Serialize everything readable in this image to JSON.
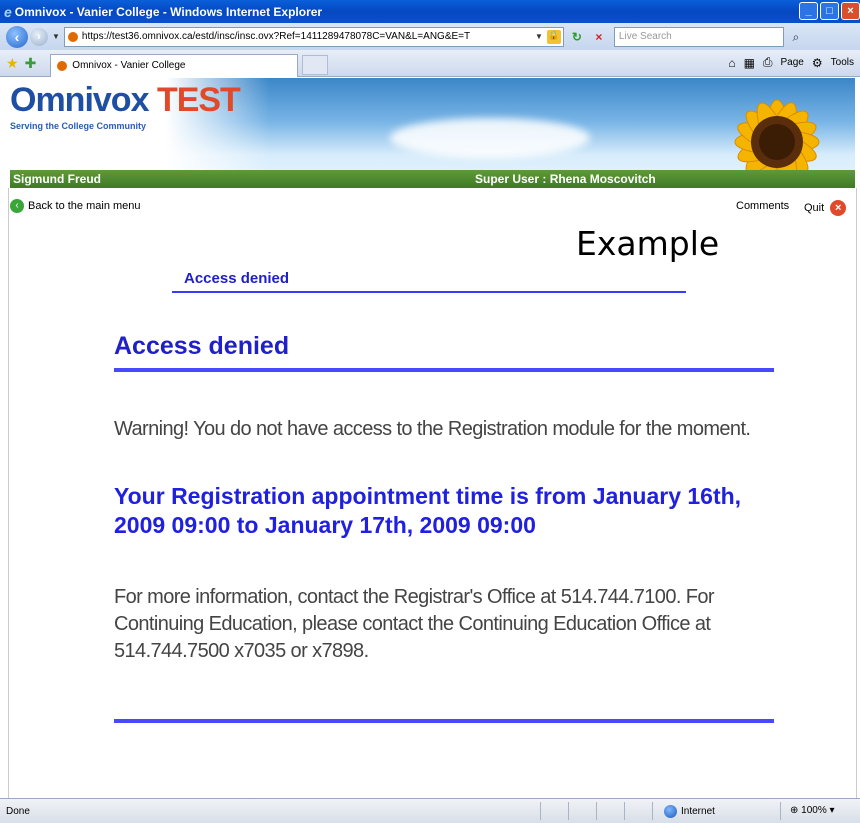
{
  "window": {
    "title": "Omnivox - Vanier College - Windows Internet Explorer"
  },
  "addressbar": {
    "url": "https://test36.omnivox.ca/estd/insc/insc.ovx?Ref=1411289478078C=VAN&L=ANG&E=T",
    "search_placeholder": "Live Search"
  },
  "tabs": {
    "active_label": "Omnivox - Vanier College",
    "commands": [
      "Page",
      "Tools"
    ]
  },
  "header": {
    "brand_part1": "Omnivox",
    "brand_part2": "TEST",
    "tagline": "Serving the College Community",
    "user_left": "Sigmund Freud",
    "user_right": "Super User : Rhena Moscovitch"
  },
  "links": {
    "back": "Back to the main menu",
    "comments": "Comments",
    "quit": "Quit"
  },
  "overlay": {
    "example": "Example"
  },
  "content": {
    "breadcrumb": "Access denied",
    "heading": "Access denied",
    "warning": "Warning! You do not have access to the Registration module for the moment.",
    "appointment": "Your Registration appointment time is from January 16th, 2009 09:00 to January 17th, 2009 09:00",
    "info": "For more information, contact the Registrar's Office at 514.744.7100. For Continuing Education, please contact the Continuing Education Office at 514.744.7500 x7035 or x7898."
  },
  "status": {
    "left": "Done",
    "zone": "Internet",
    "zoom": "100%"
  }
}
